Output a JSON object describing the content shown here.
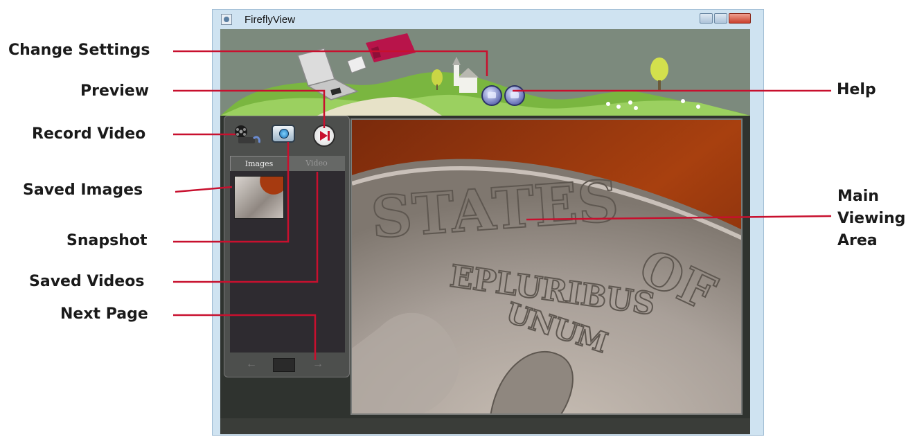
{
  "window": {
    "title": "FireflyView"
  },
  "panel": {
    "tabs": [
      {
        "label": "Images",
        "active": true
      },
      {
        "label": "Video",
        "active": false
      }
    ]
  },
  "icons": {
    "record": "film-reel-icon",
    "snapshot": "camera-icon",
    "preview": "play-record-icon",
    "settings": "settings-icon",
    "help": "help-icon"
  },
  "callouts": {
    "change_settings": "Change Settings",
    "preview": "Preview",
    "record_video": "Record Video",
    "saved_images": "Saved Images",
    "snapshot": "Snapshot",
    "saved_videos": "Saved Videos",
    "next_page": "Next Page",
    "help": "Help",
    "main_viewing_area": [
      "Main",
      "Viewing",
      "Area"
    ]
  },
  "colors": {
    "callout_line": "#c8102e",
    "window_frame": "#cfe3f1"
  }
}
